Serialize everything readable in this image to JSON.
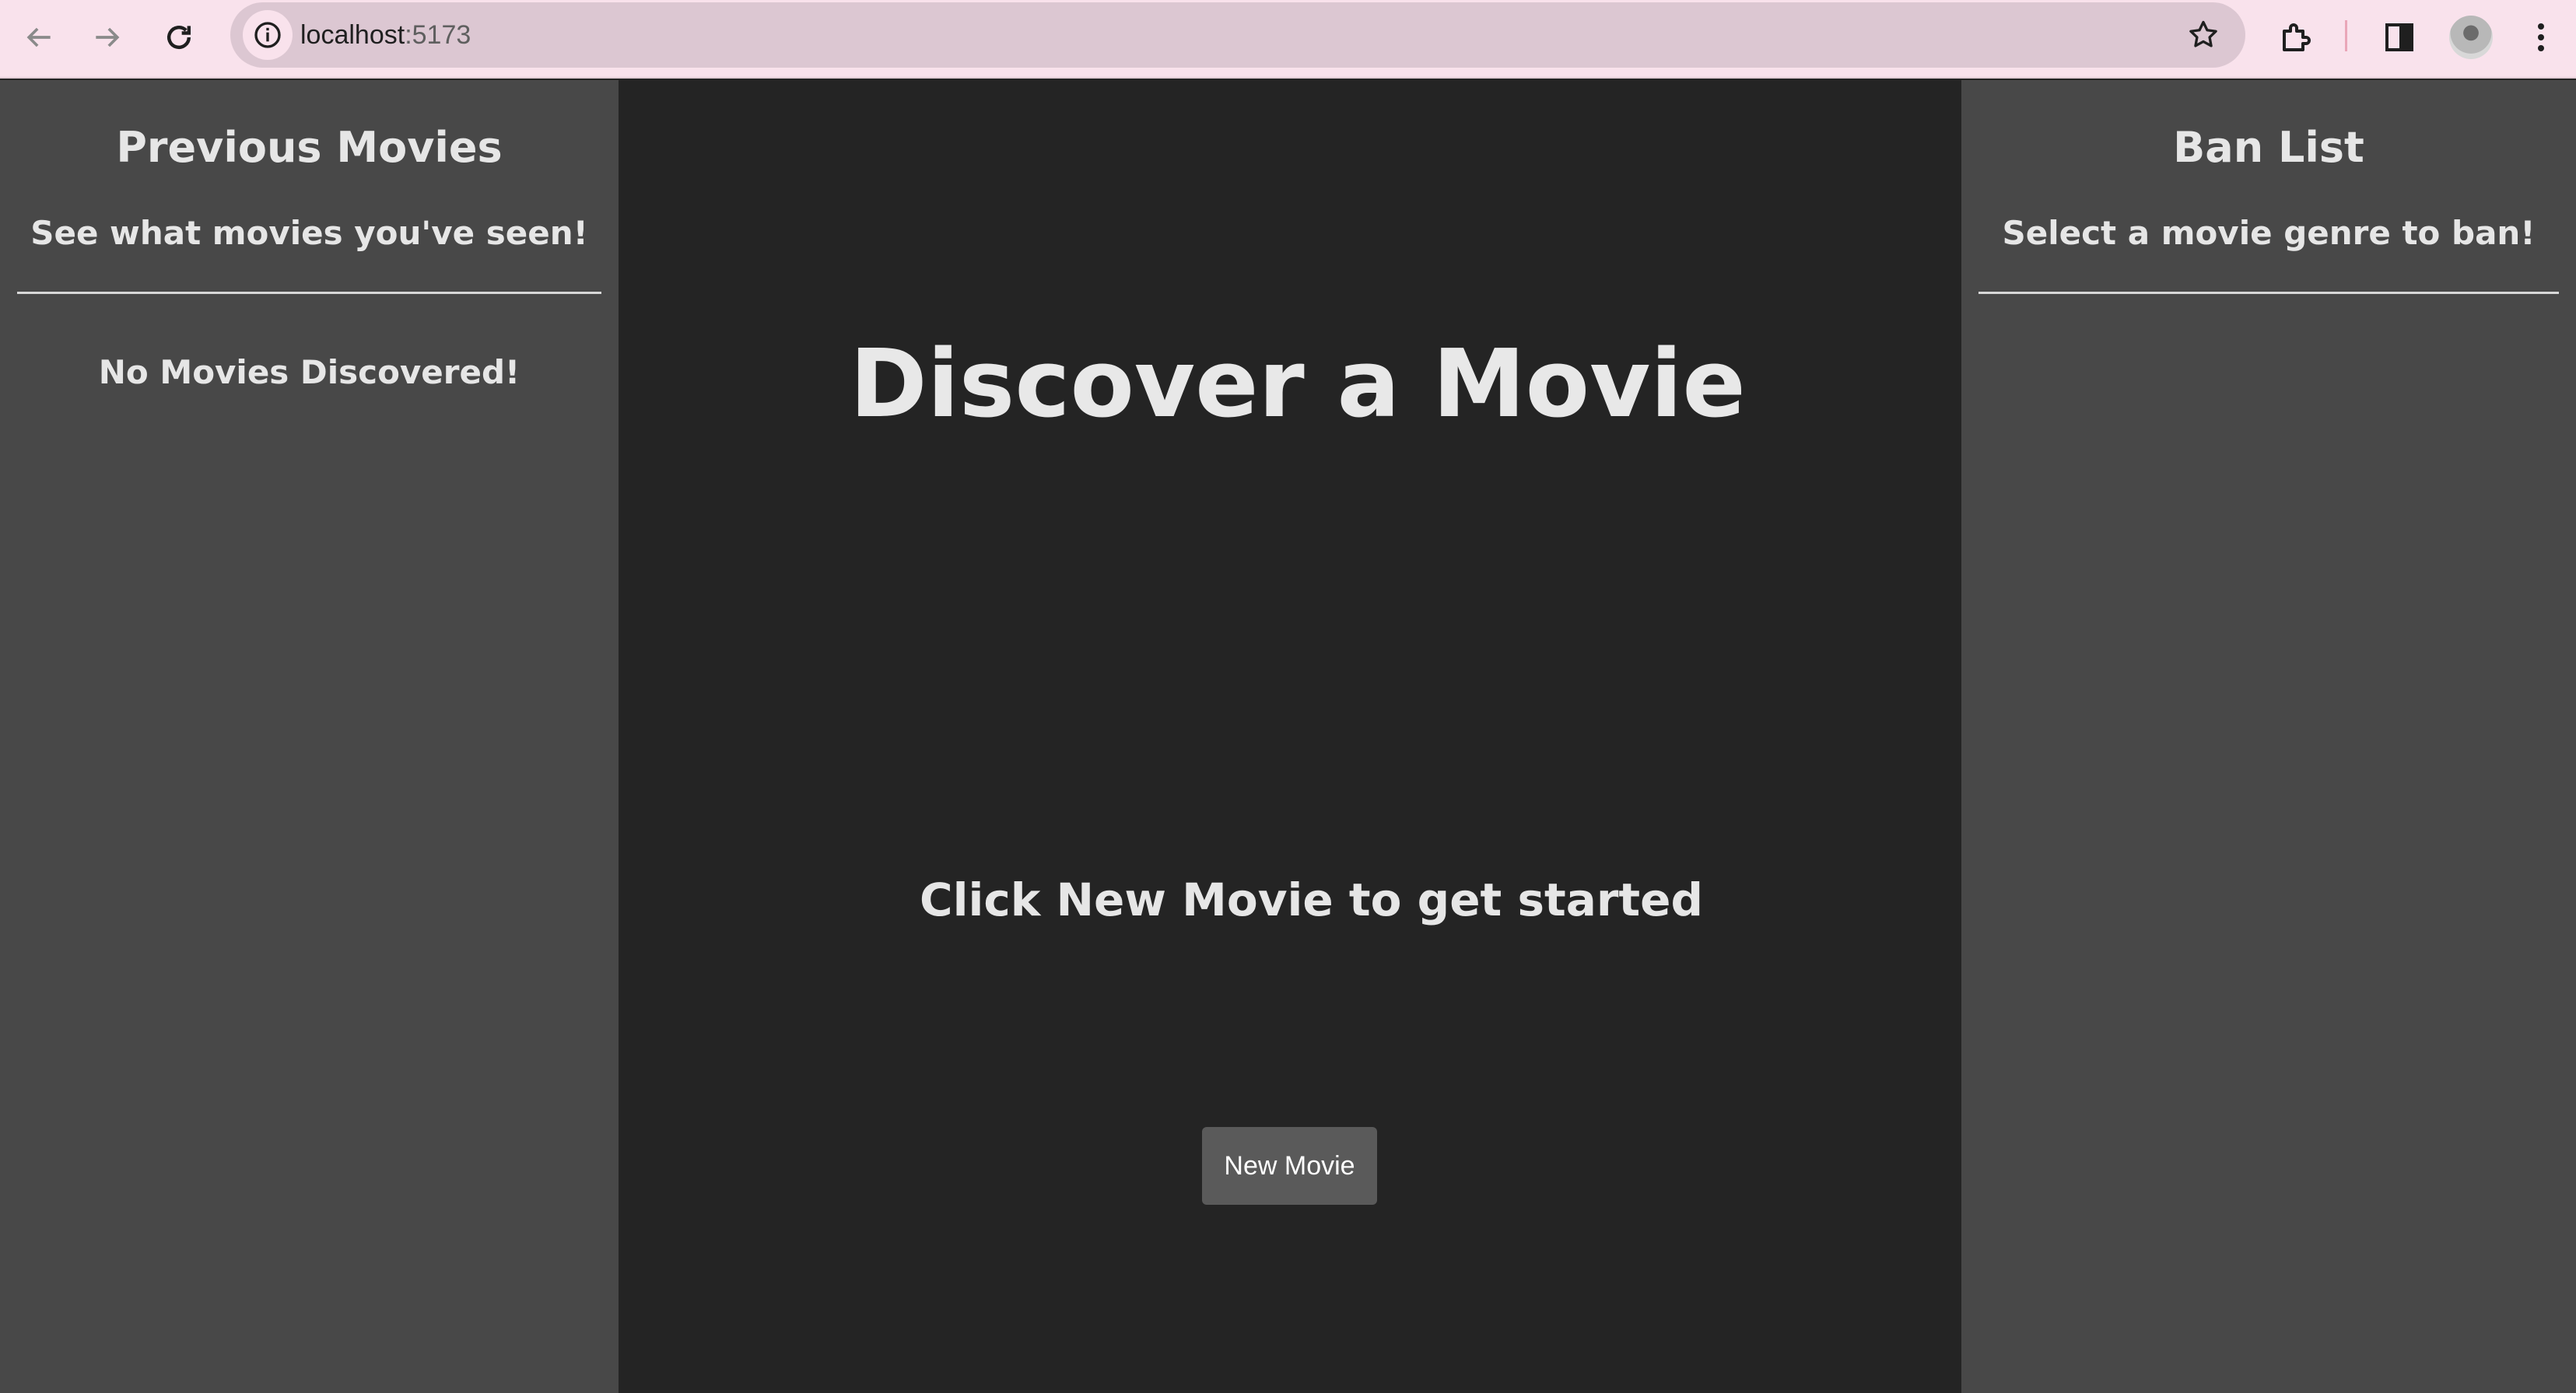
{
  "browser": {
    "url_host": "localhost",
    "url_port": ":5173"
  },
  "left_panel": {
    "title": "Previous Movies",
    "subtitle": "See what movies you've seen!",
    "empty_message": "No Movies Discovered!"
  },
  "main": {
    "title": "Discover a Movie",
    "prompt": "Click New Movie to get started",
    "new_movie_button": "New Movie"
  },
  "right_panel": {
    "title": "Ban List",
    "subtitle": "Select a movie genre to ban!"
  },
  "colors": {
    "sidebar_bg": "#484848",
    "main_bg": "#242424",
    "button_bg": "#5a5a5a",
    "chrome_bg": "#f9e2ec"
  }
}
